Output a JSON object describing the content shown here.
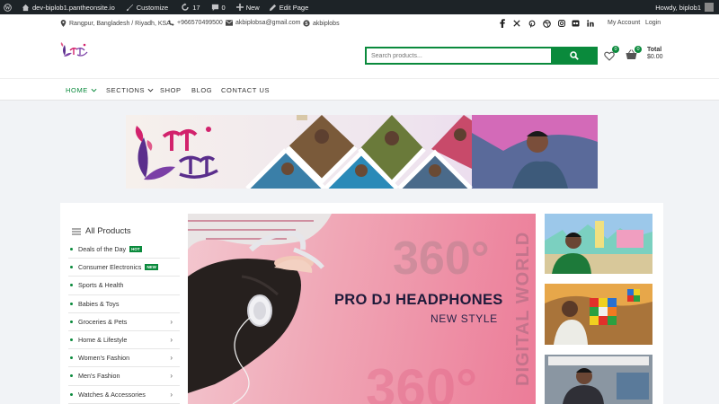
{
  "admin_bar": {
    "site_name": "dev-biplob1.pantheonsite.io",
    "customize": "Customize",
    "updates": "17",
    "comments": "0",
    "new": "New",
    "edit_page": "Edit Page",
    "howdy": "Howdy, biplob1"
  },
  "top_bar": {
    "location": "Rangpur, Bangladesh / Riyadh, KSA",
    "phone": "+966570499500",
    "email": "akbiplobsa@gmail.com",
    "skype": "akbiplobs",
    "social_icons": [
      "facebook-icon",
      "x-icon",
      "pinterest-icon",
      "dribbble-icon",
      "instagram-icon",
      "flickr-icon",
      "linkedin-icon"
    ],
    "my_account": "My Account",
    "login": "Login"
  },
  "header": {
    "search_placeholder": "Search products...",
    "wishlist_count": "0",
    "cart_count": "0",
    "total_label": "Total",
    "total_value": "$0.00"
  },
  "nav": {
    "items": [
      "HOME",
      "SECTIONS",
      "SHOP",
      "BLOG",
      "CONTACT US"
    ]
  },
  "categories": {
    "title": "All Products",
    "items": [
      {
        "label": "Deals of the Day",
        "tag": "HOT"
      },
      {
        "label": "Consumer Electronics",
        "tag": "NEW"
      },
      {
        "label": "Sports & Health"
      },
      {
        "label": "Babies & Toys"
      },
      {
        "label": "Groceries & Pets",
        "arrow": "›"
      },
      {
        "label": "Home & Lifestyle",
        "arrow": "›"
      },
      {
        "label": "Women's Fashion",
        "arrow": "›"
      },
      {
        "label": "Men's Fashion",
        "arrow": "›"
      },
      {
        "label": "Watches & Accessories",
        "arrow": "›"
      }
    ]
  },
  "hero": {
    "title": "PRO DJ HEADPHONES",
    "subtitle": "NEW STYLE",
    "bg_number": "360°",
    "vertical_text": "DIGITAL WORLD"
  },
  "colors": {
    "brand_green": "#0a8a3c",
    "admin_bar": "#1d2327",
    "hero_pink": "#ec7c98"
  }
}
